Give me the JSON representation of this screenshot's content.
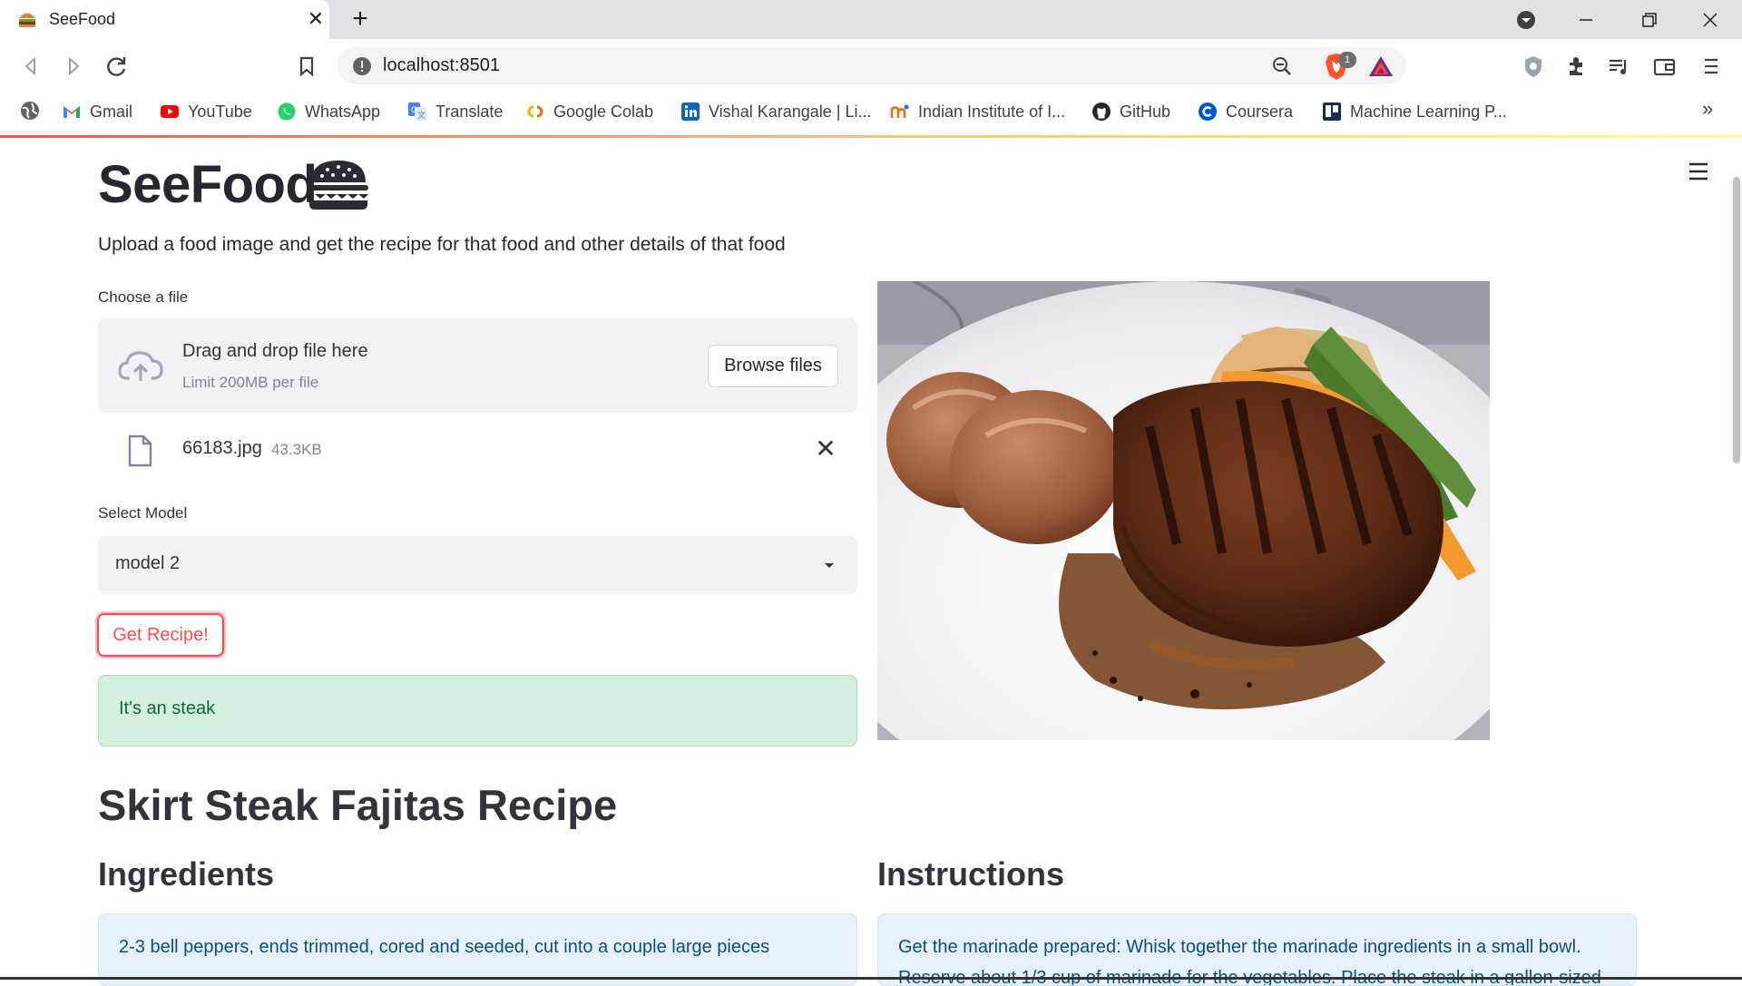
{
  "browser": {
    "tab_title": "SeeFood",
    "url": "localhost:8501",
    "brave_badge": "1",
    "bookmarks": [
      {
        "label": "Gmail",
        "icon": "gmail-icon"
      },
      {
        "label": "YouTube",
        "icon": "youtube-icon"
      },
      {
        "label": "WhatsApp",
        "icon": "whatsapp-icon"
      },
      {
        "label": "Translate",
        "icon": "translate-icon"
      },
      {
        "label": "Google Colab",
        "icon": "colab-icon"
      },
      {
        "label": "Vishal Karangale | Li...",
        "icon": "linkedin-icon"
      },
      {
        "label": "Indian Institute of I...",
        "icon": "iit-icon"
      },
      {
        "label": "GitHub",
        "icon": "github-icon"
      },
      {
        "label": "Coursera",
        "icon": "coursera-icon"
      },
      {
        "label": "Machine Learning P...",
        "icon": "trello-icon"
      }
    ],
    "more_bookmarks": "»"
  },
  "app": {
    "title": "SeeFood",
    "subtitle": "Upload a food image and get the recipe for that food and other details of that food",
    "uploader": {
      "label": "Choose a file",
      "drag_text": "Drag and drop file here",
      "limit_text": "Limit 200MB per file",
      "browse_label": "Browse files",
      "file_name": "66183.jpg",
      "file_size": "43.3KB"
    },
    "model_select": {
      "label": "Select Model",
      "value": "model 2"
    },
    "get_recipe_label": "Get Recipe!",
    "prediction": "It's an steak",
    "recipe_title": "Skirt Steak Fajitas Recipe",
    "ingredients_heading": "Ingredients",
    "instructions_heading": "Instructions",
    "ingredients_first": "2-3 bell peppers, ends trimmed, cored and seeded, cut into a couple large pieces",
    "instructions_line1": "Get the marinade prepared: Whisk together the marinade ingredients in a small bowl.",
    "instructions_line2": "Reserve about 1/3 cup of marinade for the vegetables. Place the steak in a gallon-sized"
  },
  "colors": {
    "accent": "#ff4b4b",
    "success_bg": "#d4efdf",
    "info_bg": "#e7f1fb"
  }
}
